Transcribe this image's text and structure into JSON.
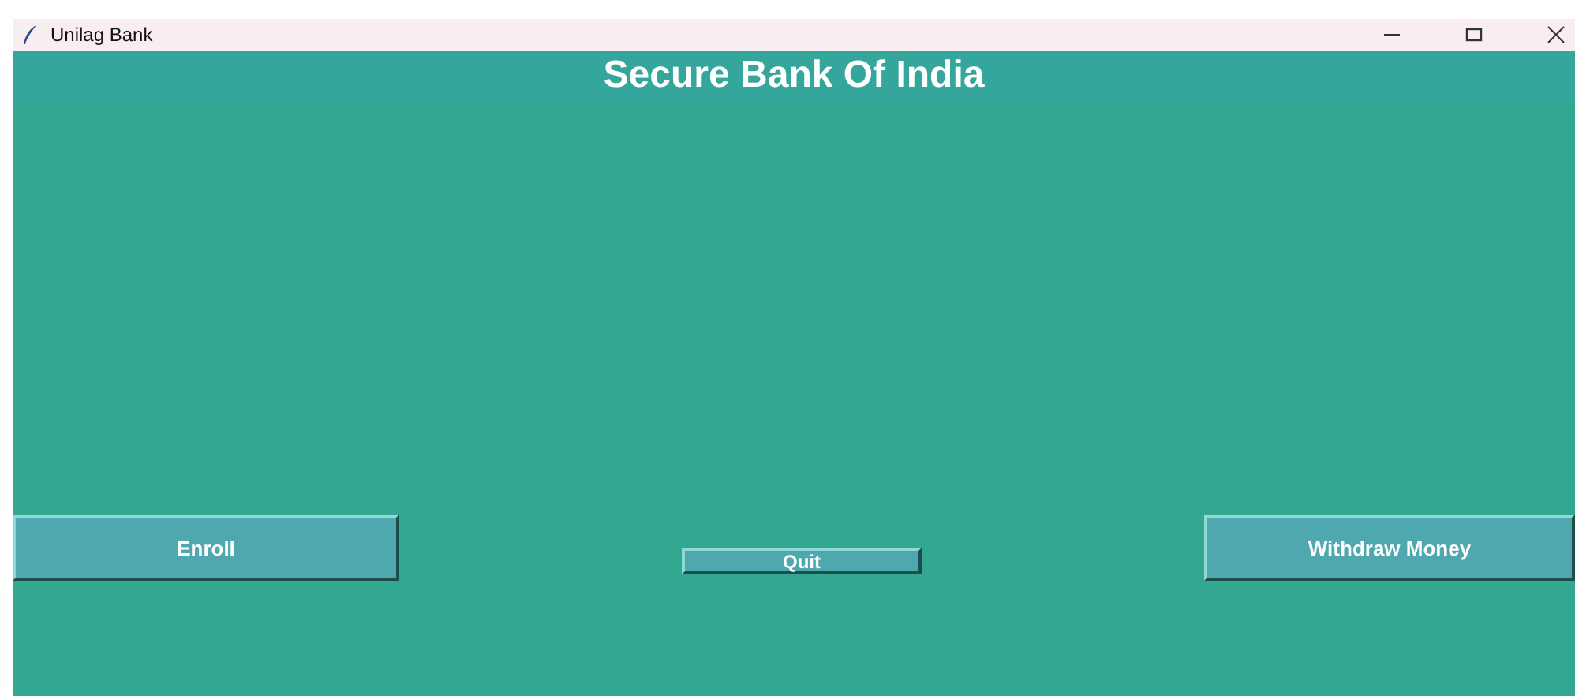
{
  "window": {
    "title": "Unilag Bank"
  },
  "header": {
    "title": "Secure Bank Of India"
  },
  "buttons": [
    {
      "label": "Enroll",
      "kind": "large"
    },
    {
      "label": "Quit",
      "kind": "small"
    },
    {
      "label": "Withdraw Money",
      "kind": "large"
    }
  ]
}
